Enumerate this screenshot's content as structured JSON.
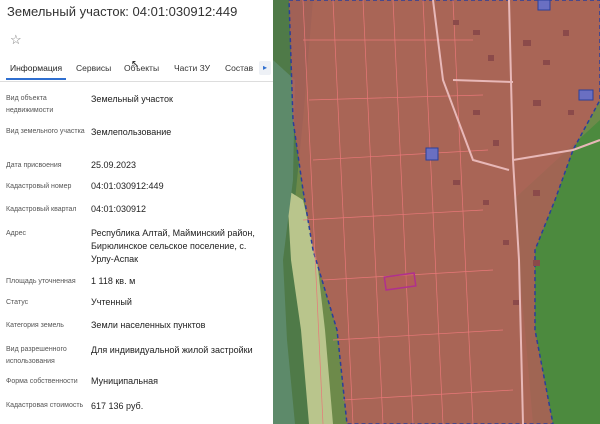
{
  "header": {
    "title": "Земельный участок: 04:01:030912:449"
  },
  "icons": {
    "favorite": "star-outline-icon",
    "next_tab": "chevron-right-icon"
  },
  "tabs": [
    {
      "label": "Информация",
      "active": true
    },
    {
      "label": "Сервисы"
    },
    {
      "label": "Объекты"
    },
    {
      "label": "Части ЗУ"
    },
    {
      "label": "Состав"
    }
  ],
  "fields": [
    {
      "label": "Вид объекта недвижимости",
      "value": "Земельный участок"
    },
    {
      "label": "Вид земельного участка",
      "value": "Землепользование"
    },
    {
      "label": "Дата присвоения",
      "value": "25.09.2023"
    },
    {
      "label": "Кадастровый номер",
      "value": "04:01:030912:449"
    },
    {
      "label": "Кадастровый квартал",
      "value": "04:01:030912"
    },
    {
      "label": "Адрес",
      "value": "Республика Алтай, Майминский район, Бирюлинское сельское поселение, с. Урлу-Аспак"
    },
    {
      "label": "Площадь уточненная",
      "value": "1 118 кв. м"
    },
    {
      "label": "Статус",
      "value": "Учтенный"
    },
    {
      "label": "Категория земель",
      "value": "Земли населенных пунктов"
    },
    {
      "label": "Вид разрешенного использования",
      "value": "Для индивидуальной жилой застройки"
    },
    {
      "label": "Форма собственности",
      "value": "Муниципальная"
    },
    {
      "label": "Кадастровая стоимость",
      "value": "617 136 руб."
    }
  ],
  "colors": {
    "accent": "#2f6fd0",
    "zone_fill": "#c0585b",
    "zone_border": "#2a3f9a",
    "highlighted_parcel": "#b0308e",
    "parcel_lines": "#e87878"
  }
}
